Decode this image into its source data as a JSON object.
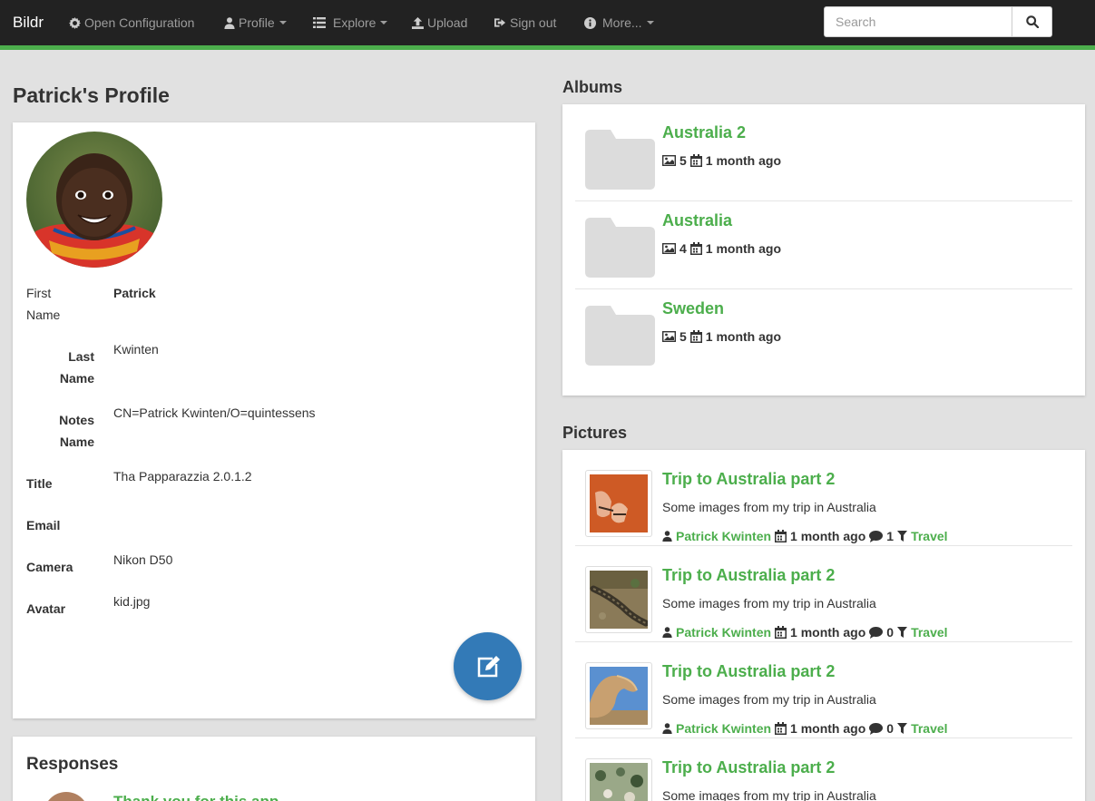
{
  "navbar": {
    "brand": "Bildr",
    "items": [
      {
        "label": "Open Configuration",
        "icon": "gear-icon"
      },
      {
        "label": "Profile",
        "icon": "user-icon",
        "dropdown": true
      },
      {
        "label": "Explore",
        "icon": "list-icon",
        "dropdown": true
      },
      {
        "label": "Upload",
        "icon": "upload-icon"
      },
      {
        "label": "Sign out",
        "icon": "sign-out-icon"
      },
      {
        "label": "More...",
        "icon": "info-icon",
        "dropdown": true
      }
    ],
    "search": {
      "placeholder": "Search",
      "value": ""
    },
    "accent_color": "#4cae4c"
  },
  "profile": {
    "title": "Patrick's Profile",
    "avatar_icon": "avatar",
    "fields": [
      {
        "label_line1": "First",
        "label_line2": "Name",
        "value": "Patrick"
      },
      {
        "label_line1": "Last",
        "label_line2": "Name",
        "value": "Kwinten"
      },
      {
        "label_line1": "Notes",
        "label_line2": "Name",
        "value": "CN=Patrick Kwinten/O=quintessens"
      },
      {
        "label": "Title",
        "value": "Tha Papparazzia 2.0.1.2"
      },
      {
        "label": "Email",
        "value": ""
      },
      {
        "label": "Camera",
        "value": "Nikon D50"
      },
      {
        "label": "Avatar",
        "value": "kid.jpg"
      }
    ],
    "edit_button_icon": "edit-icon",
    "edit_button_color": "#337ab7"
  },
  "responses": {
    "title": "Responses",
    "items": [
      {
        "text": "Thank you for this app"
      }
    ]
  },
  "albums": {
    "title": "Albums",
    "items": [
      {
        "name": "Australia 2",
        "count": "5",
        "date": "1 month ago"
      },
      {
        "name": "Australia",
        "count": "4",
        "date": "1 month ago"
      },
      {
        "name": "Sweden",
        "count": "5",
        "date": "1 month ago"
      }
    ]
  },
  "pictures": {
    "title": "Pictures",
    "items": [
      {
        "title": "Trip to Australia part 2",
        "description": "Some images from my trip in Australia",
        "author": "Patrick Kwinten",
        "date": "1 month ago",
        "comments": "1",
        "tag": "Travel"
      },
      {
        "title": "Trip to Australia part 2",
        "description": "Some images from my trip in Australia",
        "author": "Patrick Kwinten",
        "date": "1 month ago",
        "comments": "0",
        "tag": "Travel"
      },
      {
        "title": "Trip to Australia part 2",
        "description": "Some images from my trip in Australia",
        "author": "Patrick Kwinten",
        "date": "1 month ago",
        "comments": "0",
        "tag": "Travel"
      },
      {
        "title": "Trip to Australia part 2",
        "description": "Some images from my trip in Australia"
      }
    ]
  }
}
